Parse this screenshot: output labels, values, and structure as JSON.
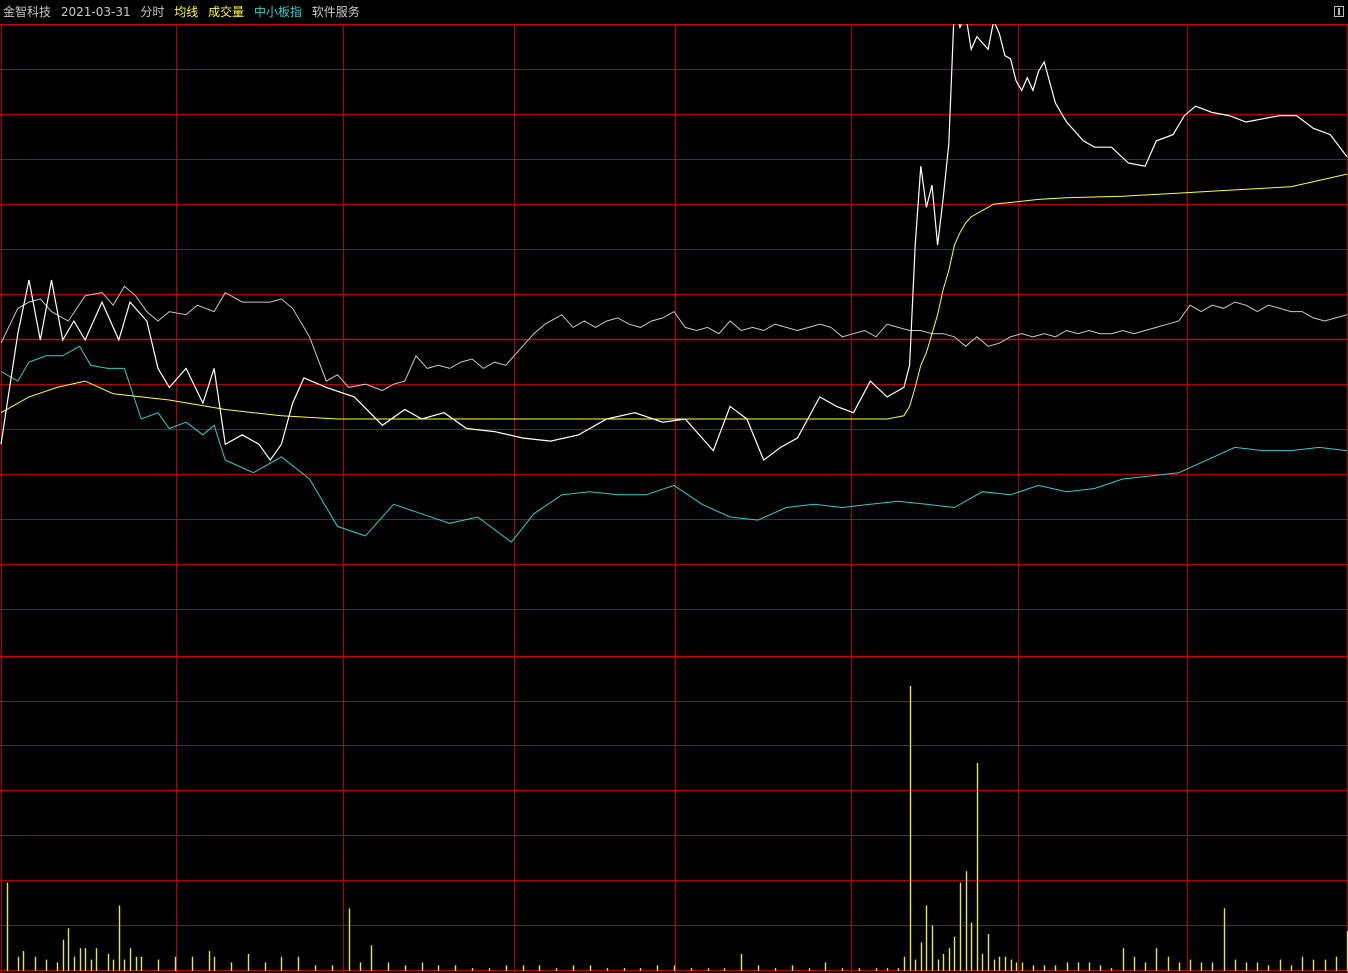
{
  "header": {
    "stock_name": "金智科技",
    "date": "2021-03-31",
    "view": "分时",
    "avg_line_label": "均线",
    "volume_label": "成交量",
    "index_label": "中小板指",
    "service_label": "软件服务"
  },
  "colors": {
    "background": "#000000",
    "grid": "#b30000",
    "grid_major": "#d20000",
    "price": "#ffffff",
    "avg": "#ffff33",
    "index": "#33cccc",
    "sector": "#c8c8c8",
    "volume": "#e6e64d"
  },
  "chart_data": {
    "type": "line",
    "title": "",
    "x_range": [
      0,
      240
    ],
    "price_range": [
      -10,
      10
    ],
    "price_points": [
      [
        0,
        -3.3
      ],
      [
        3,
        0.2
      ],
      [
        5,
        1.9
      ],
      [
        7,
        0
      ],
      [
        9,
        1.9
      ],
      [
        11,
        0
      ],
      [
        13,
        0.6
      ],
      [
        15,
        0
      ],
      [
        18,
        1.2
      ],
      [
        21,
        0
      ],
      [
        23,
        1.2
      ],
      [
        26,
        0.6
      ],
      [
        28,
        -0.9
      ],
      [
        30,
        -1.5
      ],
      [
        33,
        -0.9
      ],
      [
        36,
        -2
      ],
      [
        38,
        -0.9
      ],
      [
        40,
        -3.3
      ],
      [
        43,
        -3
      ],
      [
        46,
        -3.3
      ],
      [
        48,
        -3.8
      ],
      [
        50,
        -3.3
      ],
      [
        52,
        -2
      ],
      [
        54,
        -1.2
      ],
      [
        58,
        -1.5
      ],
      [
        63,
        -1.8
      ],
      [
        68,
        -2.7
      ],
      [
        72,
        -2.2
      ],
      [
        75,
        -2.5
      ],
      [
        79,
        -2.3
      ],
      [
        83,
        -2.8
      ],
      [
        88,
        -2.9
      ],
      [
        93,
        -3.1
      ],
      [
        98,
        -3.2
      ],
      [
        103,
        -3
      ],
      [
        108,
        -2.5
      ],
      [
        113,
        -2.3
      ],
      [
        118,
        -2.6
      ],
      [
        122,
        -2.5
      ],
      [
        127,
        -3.5
      ],
      [
        130,
        -2.1
      ],
      [
        133,
        -2.5
      ],
      [
        136,
        -3.8
      ],
      [
        139,
        -3.4
      ],
      [
        142,
        -3.1
      ],
      [
        146,
        -1.8
      ],
      [
        149,
        -2.1
      ],
      [
        152,
        -2.3
      ],
      [
        155,
        -1.3
      ],
      [
        158,
        -1.8
      ],
      [
        161,
        -1.5
      ],
      [
        162,
        -0.8
      ],
      [
        163,
        3
      ],
      [
        164,
        5.5
      ],
      [
        165,
        4.2
      ],
      [
        166,
        4.9
      ],
      [
        167,
        3
      ],
      [
        168,
        4.5
      ],
      [
        169,
        6.2
      ],
      [
        170,
        10.6
      ],
      [
        171,
        9.9
      ],
      [
        172,
        10.3
      ],
      [
        173,
        9.2
      ],
      [
        174,
        9.6
      ],
      [
        175,
        9.4
      ],
      [
        176,
        9.2
      ],
      [
        177,
        10.1
      ],
      [
        178,
        9.7
      ],
      [
        179,
        9
      ],
      [
        180,
        8.9
      ],
      [
        181,
        8.2
      ],
      [
        182,
        7.9
      ],
      [
        183,
        8.3
      ],
      [
        184,
        7.9
      ],
      [
        185,
        8.5
      ],
      [
        186,
        8.8
      ],
      [
        188,
        7.5
      ],
      [
        190,
        6.9
      ],
      [
        193,
        6.3
      ],
      [
        195,
        6.1
      ],
      [
        198,
        6.1
      ],
      [
        201,
        5.6
      ],
      [
        204,
        5.5
      ],
      [
        206,
        6.3
      ],
      [
        209,
        6.5
      ],
      [
        211,
        7.1
      ],
      [
        213,
        7.4
      ],
      [
        216,
        7.2
      ],
      [
        219,
        7.1
      ],
      [
        222,
        6.9
      ],
      [
        225,
        7
      ],
      [
        228,
        7.1
      ],
      [
        231,
        7.1
      ],
      [
        234,
        6.7
      ],
      [
        237,
        6.5
      ],
      [
        240,
        5.8
      ]
    ],
    "avg_points": [
      [
        0,
        -2.3
      ],
      [
        5,
        -1.8
      ],
      [
        10,
        -1.5
      ],
      [
        15,
        -1.3
      ],
      [
        20,
        -1.7
      ],
      [
        25,
        -1.8
      ],
      [
        30,
        -1.9
      ],
      [
        40,
        -2.2
      ],
      [
        50,
        -2.4
      ],
      [
        60,
        -2.5
      ],
      [
        70,
        -2.5
      ],
      [
        80,
        -2.5
      ],
      [
        90,
        -2.5
      ],
      [
        100,
        -2.5
      ],
      [
        110,
        -2.5
      ],
      [
        120,
        -2.5
      ],
      [
        130,
        -2.5
      ],
      [
        140,
        -2.5
      ],
      [
        150,
        -2.5
      ],
      [
        158,
        -2.5
      ],
      [
        161,
        -2.4
      ],
      [
        162,
        -2.1
      ],
      [
        163,
        -1.5
      ],
      [
        164,
        -0.8
      ],
      [
        165,
        -0.4
      ],
      [
        166,
        0.2
      ],
      [
        167,
        0.8
      ],
      [
        168,
        1.6
      ],
      [
        169,
        2.2
      ],
      [
        170,
        3
      ],
      [
        171,
        3.4
      ],
      [
        172,
        3.7
      ],
      [
        173,
        3.9
      ],
      [
        174,
        4
      ],
      [
        175,
        4.1
      ],
      [
        176,
        4.2
      ],
      [
        177,
        4.3
      ],
      [
        180,
        4.35
      ],
      [
        185,
        4.45
      ],
      [
        190,
        4.5
      ],
      [
        200,
        4.55
      ],
      [
        210,
        4.65
      ],
      [
        220,
        4.75
      ],
      [
        230,
        4.85
      ],
      [
        240,
        5.25
      ]
    ],
    "index_points": [
      [
        0,
        -1
      ],
      [
        3,
        -1.3
      ],
      [
        5,
        -0.7
      ],
      [
        8,
        -0.5
      ],
      [
        11,
        -0.5
      ],
      [
        14,
        -0.2
      ],
      [
        16,
        -0.8
      ],
      [
        19,
        -0.9
      ],
      [
        22,
        -0.9
      ],
      [
        25,
        -2.5
      ],
      [
        28,
        -2.3
      ],
      [
        30,
        -2.8
      ],
      [
        33,
        -2.6
      ],
      [
        36,
        -3
      ],
      [
        38,
        -2.7
      ],
      [
        40,
        -3.8
      ],
      [
        45,
        -4.2
      ],
      [
        50,
        -3.7
      ],
      [
        55,
        -4.4
      ],
      [
        60,
        -5.9
      ],
      [
        65,
        -6.2
      ],
      [
        70,
        -5.2
      ],
      [
        75,
        -5.5
      ],
      [
        80,
        -5.8
      ],
      [
        85,
        -5.6
      ],
      [
        91,
        -6.4
      ],
      [
        95,
        -5.5
      ],
      [
        100,
        -4.9
      ],
      [
        105,
        -4.8
      ],
      [
        110,
        -4.9
      ],
      [
        115,
        -4.9
      ],
      [
        120,
        -4.6
      ],
      [
        125,
        -5.2
      ],
      [
        130,
        -5.6
      ],
      [
        135,
        -5.7
      ],
      [
        140,
        -5.3
      ],
      [
        145,
        -5.2
      ],
      [
        150,
        -5.3
      ],
      [
        155,
        -5.2
      ],
      [
        160,
        -5.1
      ],
      [
        165,
        -5.2
      ],
      [
        170,
        -5.3
      ],
      [
        175,
        -4.8
      ],
      [
        180,
        -4.9
      ],
      [
        185,
        -4.6
      ],
      [
        190,
        -4.8
      ],
      [
        195,
        -4.7
      ],
      [
        200,
        -4.4
      ],
      [
        205,
        -4.3
      ],
      [
        210,
        -4.2
      ],
      [
        215,
        -3.8
      ],
      [
        220,
        -3.4
      ],
      [
        225,
        -3.5
      ],
      [
        230,
        -3.5
      ],
      [
        235,
        -3.4
      ],
      [
        240,
        -3.5
      ]
    ],
    "sector_points": [
      [
        0,
        -0.1
      ],
      [
        3,
        1
      ],
      [
        5,
        1.2
      ],
      [
        7,
        1.3
      ],
      [
        9,
        0.9
      ],
      [
        12,
        0.6
      ],
      [
        15,
        1.4
      ],
      [
        18,
        1.5
      ],
      [
        20,
        1.1
      ],
      [
        22,
        1.7
      ],
      [
        24,
        1.4
      ],
      [
        26,
        0.9
      ],
      [
        28,
        0.6
      ],
      [
        30,
        0.9
      ],
      [
        33,
        0.8
      ],
      [
        35,
        1.1
      ],
      [
        38,
        0.9
      ],
      [
        40,
        1.5
      ],
      [
        43,
        1.2
      ],
      [
        45,
        1.2
      ],
      [
        48,
        1.2
      ],
      [
        50,
        1.3
      ],
      [
        52,
        1
      ],
      [
        55,
        0.1
      ],
      [
        58,
        -1.3
      ],
      [
        60,
        -1.1
      ],
      [
        62,
        -1.5
      ],
      [
        65,
        -1.4
      ],
      [
        68,
        -1.6
      ],
      [
        70,
        -1.4
      ],
      [
        72,
        -1.3
      ],
      [
        74,
        -0.5
      ],
      [
        76,
        -0.9
      ],
      [
        78,
        -0.8
      ],
      [
        80,
        -0.9
      ],
      [
        82,
        -0.7
      ],
      [
        84,
        -0.6
      ],
      [
        86,
        -0.9
      ],
      [
        88,
        -0.7
      ],
      [
        90,
        -0.8
      ],
      [
        92,
        -0.4
      ],
      [
        95,
        0.2
      ],
      [
        97,
        0.5
      ],
      [
        100,
        0.8
      ],
      [
        102,
        0.4
      ],
      [
        104,
        0.6
      ],
      [
        106,
        0.4
      ],
      [
        108,
        0.6
      ],
      [
        110,
        0.7
      ],
      [
        112,
        0.5
      ],
      [
        114,
        0.4
      ],
      [
        116,
        0.6
      ],
      [
        118,
        0.7
      ],
      [
        120,
        0.9
      ],
      [
        122,
        0.4
      ],
      [
        124,
        0.3
      ],
      [
        126,
        0.4
      ],
      [
        128,
        0.2
      ],
      [
        130,
        0.6
      ],
      [
        132,
        0.3
      ],
      [
        134,
        0.4
      ],
      [
        136,
        0.3
      ],
      [
        138,
        0.5
      ],
      [
        140,
        0.4
      ],
      [
        142,
        0.3
      ],
      [
        144,
        0.4
      ],
      [
        146,
        0.5
      ],
      [
        148,
        0.4
      ],
      [
        150,
        0.1
      ],
      [
        152,
        0.2
      ],
      [
        154,
        0.3
      ],
      [
        156,
        0.1
      ],
      [
        158,
        0.5
      ],
      [
        160,
        0.4
      ],
      [
        162,
        0.3
      ],
      [
        164,
        0.3
      ],
      [
        166,
        0.2
      ],
      [
        168,
        0.2
      ],
      [
        170,
        0.1
      ],
      [
        172,
        -0.2
      ],
      [
        174,
        0.1
      ],
      [
        176,
        -0.2
      ],
      [
        178,
        -0.1
      ],
      [
        180,
        0.1
      ],
      [
        182,
        0.2
      ],
      [
        184,
        0.1
      ],
      [
        186,
        0.2
      ],
      [
        188,
        0.1
      ],
      [
        190,
        0.3
      ],
      [
        192,
        0.2
      ],
      [
        194,
        0.3
      ],
      [
        196,
        0.2
      ],
      [
        198,
        0.2
      ],
      [
        200,
        0.3
      ],
      [
        202,
        0.2
      ],
      [
        204,
        0.3
      ],
      [
        206,
        0.4
      ],
      [
        208,
        0.5
      ],
      [
        210,
        0.6
      ],
      [
        212,
        1.1
      ],
      [
        214,
        0.9
      ],
      [
        216,
        1.1
      ],
      [
        218,
        1
      ],
      [
        220,
        1.2
      ],
      [
        222,
        1.1
      ],
      [
        224,
        0.9
      ],
      [
        226,
        1.1
      ],
      [
        228,
        1
      ],
      [
        230,
        0.9
      ],
      [
        232,
        0.9
      ],
      [
        234,
        0.7
      ],
      [
        236,
        0.6
      ],
      [
        238,
        0.7
      ],
      [
        240,
        0.8
      ]
    ],
    "volume_range": [
      0,
      100
    ],
    "volume_bars": [
      [
        1,
        31
      ],
      [
        3,
        5
      ],
      [
        4,
        7
      ],
      [
        6,
        5
      ],
      [
        8,
        4
      ],
      [
        10,
        3
      ],
      [
        11,
        11
      ],
      [
        12,
        15
      ],
      [
        13,
        5
      ],
      [
        14,
        8
      ],
      [
        15,
        8
      ],
      [
        16,
        4
      ],
      [
        17,
        8
      ],
      [
        19,
        6
      ],
      [
        20,
        4
      ],
      [
        21,
        23
      ],
      [
        22,
        4
      ],
      [
        23,
        8
      ],
      [
        24,
        5
      ],
      [
        25,
        5
      ],
      [
        28,
        4
      ],
      [
        31,
        5
      ],
      [
        34,
        5
      ],
      [
        37,
        7
      ],
      [
        38,
        5
      ],
      [
        41,
        3
      ],
      [
        44,
        6
      ],
      [
        47,
        3
      ],
      [
        50,
        5
      ],
      [
        53,
        5
      ],
      [
        56,
        2
      ],
      [
        59,
        2
      ],
      [
        62,
        22
      ],
      [
        64,
        3
      ],
      [
        66,
        9
      ],
      [
        69,
        3
      ],
      [
        72,
        2
      ],
      [
        75,
        3
      ],
      [
        78,
        2
      ],
      [
        81,
        2
      ],
      [
        84,
        1
      ],
      [
        87,
        1
      ],
      [
        90,
        2
      ],
      [
        93,
        2
      ],
      [
        96,
        2
      ],
      [
        99,
        1
      ],
      [
        102,
        2
      ],
      [
        105,
        2
      ],
      [
        108,
        1
      ],
      [
        111,
        1
      ],
      [
        114,
        1
      ],
      [
        117,
        2
      ],
      [
        120,
        2
      ],
      [
        123,
        1
      ],
      [
        126,
        1
      ],
      [
        129,
        1
      ],
      [
        132,
        6
      ],
      [
        135,
        2
      ],
      [
        138,
        1
      ],
      [
        141,
        2
      ],
      [
        144,
        1
      ],
      [
        147,
        3
      ],
      [
        150,
        1
      ],
      [
        153,
        1
      ],
      [
        156,
        1
      ],
      [
        158,
        1
      ],
      [
        160,
        1
      ],
      [
        161,
        5
      ],
      [
        162,
        100
      ],
      [
        163,
        4
      ],
      [
        164,
        10
      ],
      [
        165,
        23
      ],
      [
        166,
        16
      ],
      [
        167,
        4
      ],
      [
        168,
        6
      ],
      [
        169,
        8
      ],
      [
        170,
        12
      ],
      [
        171,
        31
      ],
      [
        172,
        35
      ],
      [
        173,
        17
      ],
      [
        174,
        73
      ],
      [
        175,
        6
      ],
      [
        176,
        13
      ],
      [
        177,
        4
      ],
      [
        178,
        5
      ],
      [
        179,
        5
      ],
      [
        180,
        4
      ],
      [
        181,
        3
      ],
      [
        182,
        3
      ],
      [
        184,
        2
      ],
      [
        186,
        2
      ],
      [
        188,
        2
      ],
      [
        190,
        3
      ],
      [
        192,
        3
      ],
      [
        194,
        3
      ],
      [
        196,
        2
      ],
      [
        198,
        1
      ],
      [
        200,
        8
      ],
      [
        202,
        5
      ],
      [
        204,
        3
      ],
      [
        206,
        8
      ],
      [
        208,
        5
      ],
      [
        210,
        3
      ],
      [
        212,
        4
      ],
      [
        214,
        3
      ],
      [
        216,
        3
      ],
      [
        218,
        22
      ],
      [
        220,
        4
      ],
      [
        222,
        3
      ],
      [
        224,
        3
      ],
      [
        226,
        2
      ],
      [
        228,
        4
      ],
      [
        230,
        2
      ],
      [
        232,
        5
      ],
      [
        234,
        4
      ],
      [
        236,
        4
      ],
      [
        238,
        5
      ],
      [
        240,
        14
      ]
    ]
  }
}
